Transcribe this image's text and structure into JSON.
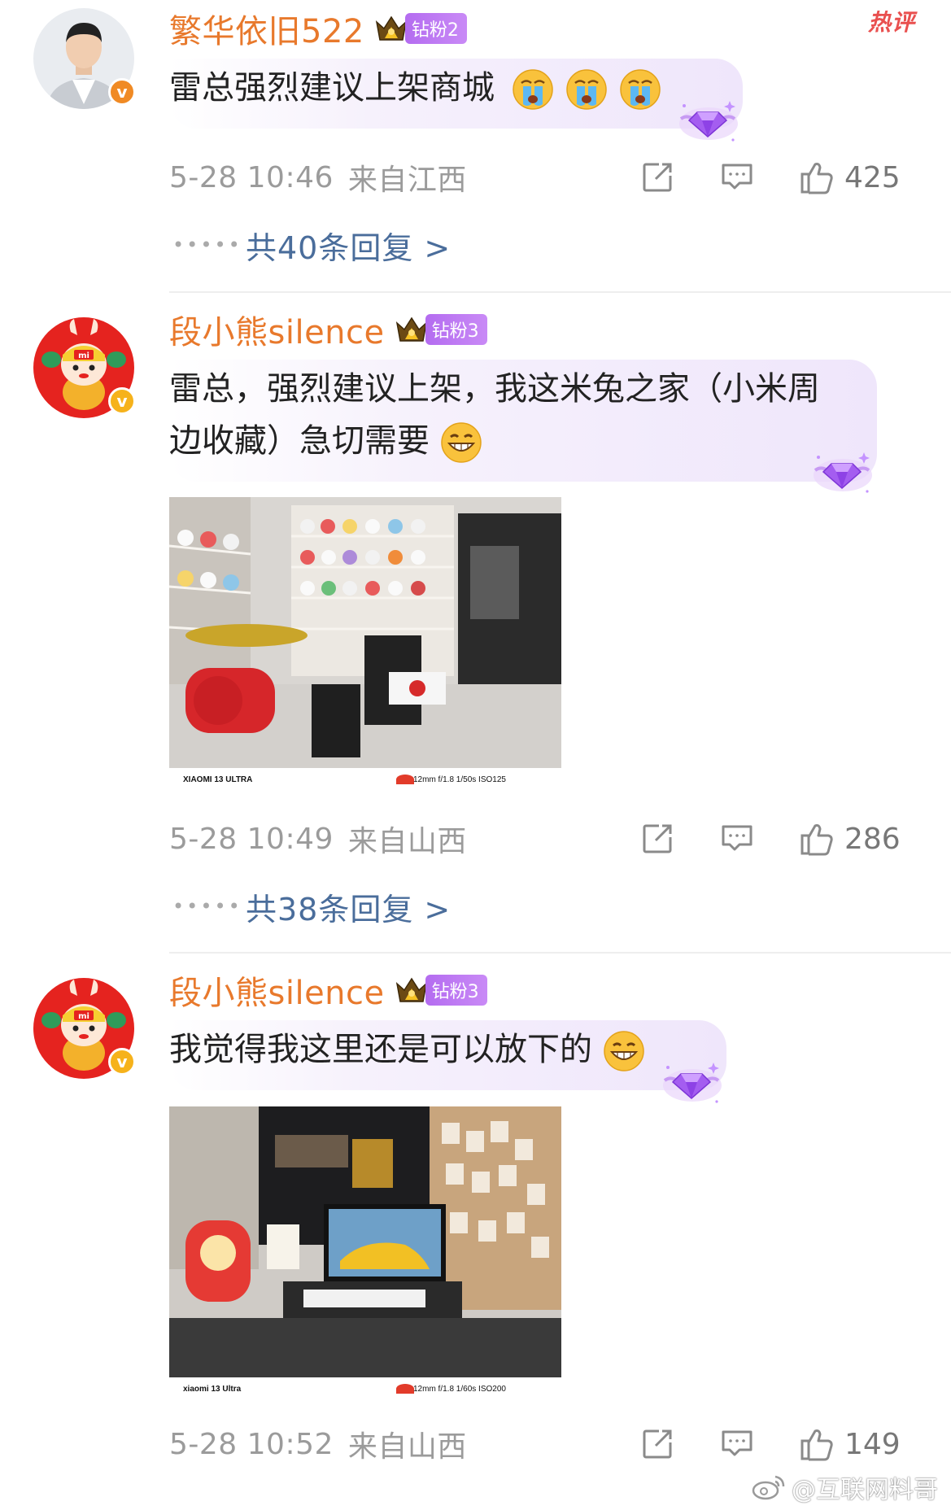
{
  "hot_tag": "热评",
  "comments": [
    {
      "username": "繁华依旧522",
      "fan_badge": "钻粉2",
      "text": "雷总强烈建议上架商城",
      "emoji_icons": [
        "crying-emoji",
        "crying-emoji",
        "crying-emoji"
      ],
      "timestamp": "5-28 10:46",
      "location": "来自江西",
      "likes": "425",
      "reply_link": "共40条回复 >"
    },
    {
      "username": "段小熊silence",
      "fan_badge": "钻粉3",
      "text_line1": "雷总，强烈建议上架，我这米兔之家（小米周",
      "text_line2": "边收藏）急切需要",
      "emoji_icons": [
        "grinning-emoji"
      ],
      "photo_caption_brand": "XIAOMI 13 ULTRA",
      "photo_caption_lens": "12mm  f/1.8  1/50s  ISO125",
      "timestamp": "5-28 10:49",
      "location": "来自山西",
      "likes": "286",
      "reply_link": "共38条回复 >"
    },
    {
      "username": "段小熊silence",
      "fan_badge": "钻粉3",
      "text": "我觉得我这里还是可以放下的",
      "emoji_icons": [
        "grinning-emoji"
      ],
      "photo_caption_brand": "xiaomi 13 Ultra",
      "photo_caption_lens": "12mm  f/1.8  1/60s  ISO200",
      "timestamp": "5-28 10:52",
      "location": "来自山西",
      "likes": "149"
    }
  ],
  "watermark": "@互联网料哥",
  "colors": {
    "username": "#e8792c",
    "reply_link": "#4a6d9b",
    "hot_tag": "#e9504f",
    "fan_badge": "#b46cf0",
    "meta_gray": "#9b9b9b"
  }
}
